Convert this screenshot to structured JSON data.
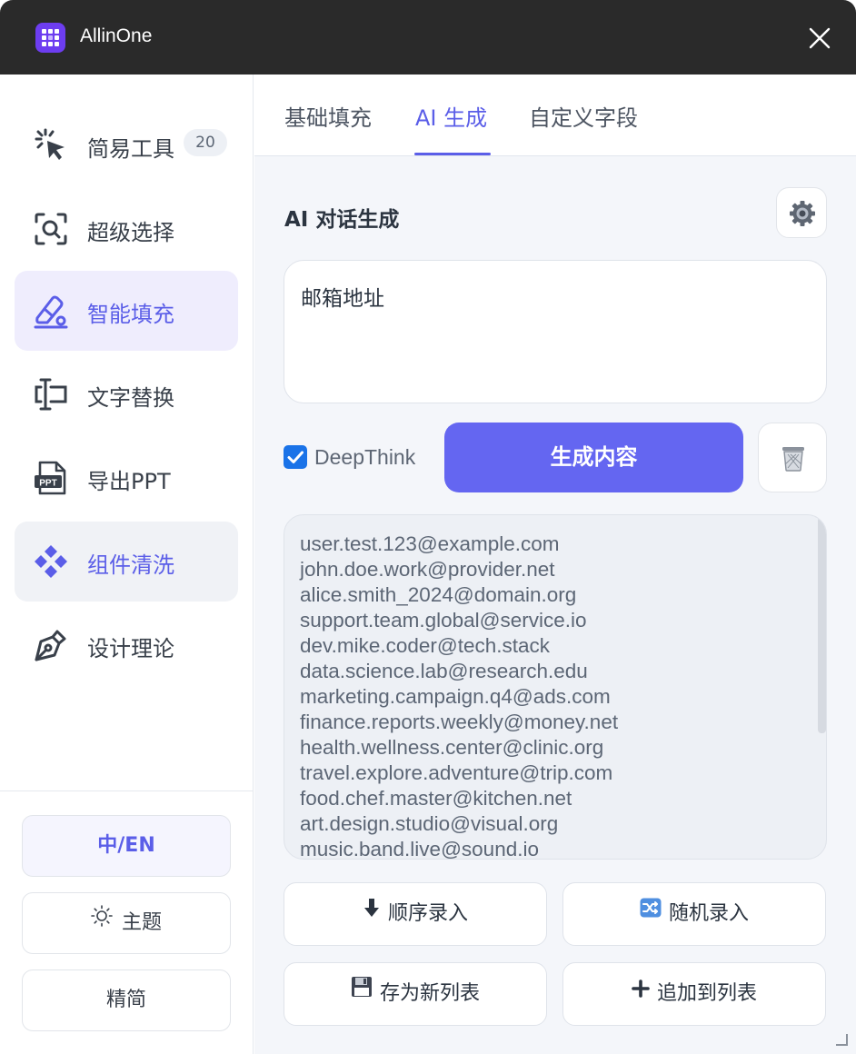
{
  "app": {
    "title": "AllinOne"
  },
  "sidebar": {
    "items": [
      {
        "label": "简易工具",
        "badge": "20",
        "icon": "cursor-click-icon"
      },
      {
        "label": "超级选择",
        "icon": "scan-search-icon"
      },
      {
        "label": "智能填充",
        "icon": "eraser-pen-icon",
        "state": "active"
      },
      {
        "label": "文字替换",
        "icon": "text-cursor-icon"
      },
      {
        "label": "导出PPT",
        "icon": "ppt-file-icon"
      },
      {
        "label": "组件清洗",
        "icon": "diamond-cluster-icon",
        "state": "hover"
      },
      {
        "label": "设计理论",
        "icon": "pen-nib-icon"
      }
    ],
    "buttons": {
      "language": "中/EN",
      "theme": "主题",
      "compact": "精简"
    }
  },
  "tabs": [
    {
      "label": "基础填充"
    },
    {
      "label": "AI 生成",
      "active": true
    },
    {
      "label": "自定义字段"
    }
  ],
  "ai": {
    "section_title": "AI 对话生成",
    "prompt": "邮箱地址",
    "deepthink_label": "DeepThink",
    "deepthink_checked": true,
    "generate_label": "生成内容",
    "output_lines": [
      "user.test.123@example.com",
      "john.doe.work@provider.net",
      "alice.smith_2024@domain.org",
      "support.team.global@service.io",
      "dev.mike.coder@tech.stack",
      "data.science.lab@research.edu",
      "marketing.campaign.q4@ads.com",
      "finance.reports.weekly@money.net",
      "health.wellness.center@clinic.org",
      "travel.explore.adventure@trip.com",
      "food.chef.master@kitchen.net",
      "art.design.studio@visual.org",
      "music.band.live@sound.io"
    ]
  },
  "actions": {
    "sequential": "顺序录入",
    "random": "随机录入",
    "save_new_list": "存为新列表",
    "append_to_list": "追加到列表"
  },
  "colors": {
    "accent": "#6466f1",
    "titlebar": "#2a2a2a",
    "checkbox": "#1a73e8"
  }
}
